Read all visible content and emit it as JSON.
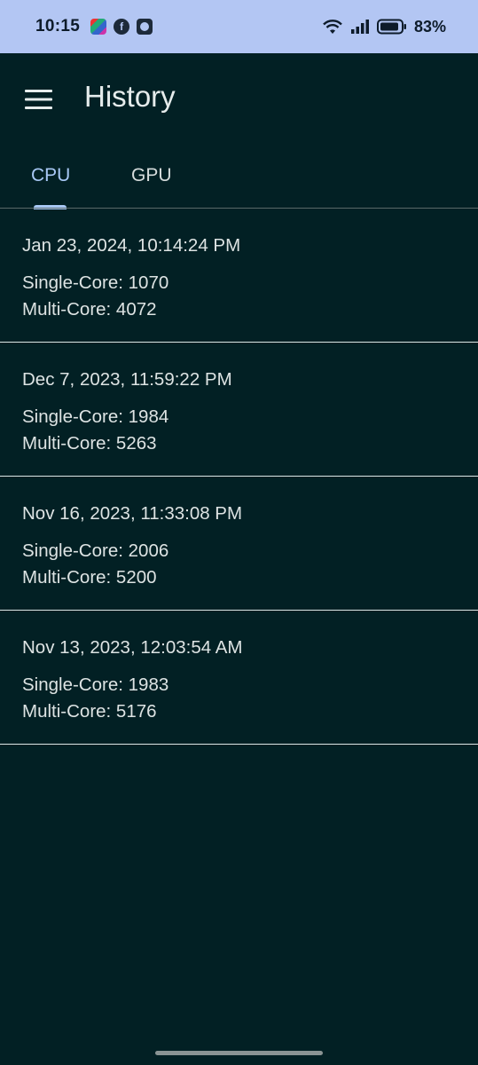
{
  "status_bar": {
    "time": "10:15",
    "battery_percent": "83%",
    "notification_icons": [
      "mj-app-icon",
      "facebook-icon",
      "square-app-icon"
    ]
  },
  "app_bar": {
    "title": "History",
    "menu_icon": "hamburger-menu-icon"
  },
  "tabs": [
    {
      "label": "CPU",
      "active": true
    },
    {
      "label": "GPU",
      "active": false
    }
  ],
  "history": [
    {
      "date": "Jan 23, 2024, 10:14:24 PM",
      "single_core": "Single-Core: 1070",
      "multi_core": "Multi-Core: 4072"
    },
    {
      "date": "Dec 7, 2023, 11:59:22 PM",
      "single_core": "Single-Core: 1984",
      "multi_core": "Multi-Core: 5263"
    },
    {
      "date": "Nov 16, 2023, 11:33:08 PM",
      "single_core": "Single-Core: 2006",
      "multi_core": "Multi-Core: 5200"
    },
    {
      "date": "Nov 13, 2023, 12:03:54 AM",
      "single_core": "Single-Core: 1983",
      "multi_core": "Multi-Core: 5176"
    }
  ],
  "colors": {
    "background": "#022024",
    "status_bar": "#b3c6f3",
    "accent": "#a8c8f5",
    "divider": "#dfe6e6"
  }
}
